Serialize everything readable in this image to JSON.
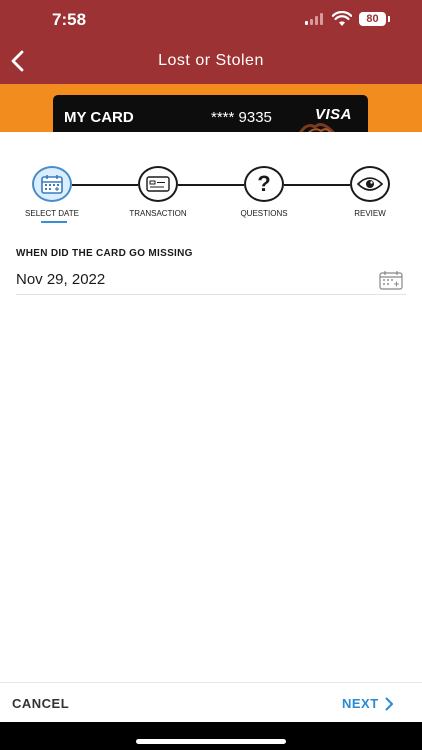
{
  "status": {
    "time": "7:58",
    "battery": "80"
  },
  "header": {
    "title": "Lost or Stolen"
  },
  "card": {
    "name": "MY CARD",
    "number": "**** 9335",
    "brand": "VISA"
  },
  "steps": [
    {
      "label": "SELECT DATE",
      "icon": "calendar-icon",
      "active": true
    },
    {
      "label": "TRANSACTION",
      "icon": "credit-card-icon",
      "active": false
    },
    {
      "label": "QUESTIONS",
      "icon": "question-icon",
      "active": false
    },
    {
      "label": "REVIEW",
      "icon": "eye-icon",
      "active": false
    }
  ],
  "form": {
    "label": "WHEN DID THE CARD GO MISSING",
    "date_value": "Nov 29, 2022"
  },
  "footer": {
    "cancel_label": "CANCEL",
    "next_label": "NEXT"
  },
  "colors": {
    "header": "#9c3233",
    "strip": "#f28c1e",
    "accent": "#2a8ad2"
  }
}
